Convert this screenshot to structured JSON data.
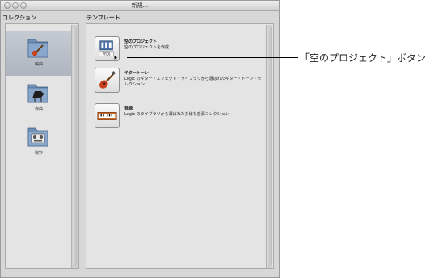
{
  "window": {
    "title": "新規..."
  },
  "collections": {
    "header": "コレクション",
    "items": [
      {
        "label": "編曲",
        "icon": "guitar-folder-icon",
        "selected": true
      },
      {
        "label": "作曲",
        "icon": "piano-folder-icon",
        "selected": false
      },
      {
        "label": "製作",
        "icon": "mixer-folder-icon",
        "selected": false
      }
    ]
  },
  "templates": {
    "header": "テンプレート",
    "items": [
      {
        "title": "空のプロジェクト",
        "description": "空のプロジェクトを作成",
        "icon": "empty-project-icon",
        "icon_text": "PROJ"
      },
      {
        "title": "ギタートーン",
        "description": "Logic のギター・エフェクト・ライブラリから選ばれたギター・トーン・セレクション",
        "icon": "guitar-icon"
      },
      {
        "title": "音源",
        "description": "Logic のライブラリから選ばれた多様な音源コレクション",
        "icon": "keyboard-icon"
      }
    ]
  },
  "callout": {
    "text": "「空のプロジェクト」ボタン"
  }
}
